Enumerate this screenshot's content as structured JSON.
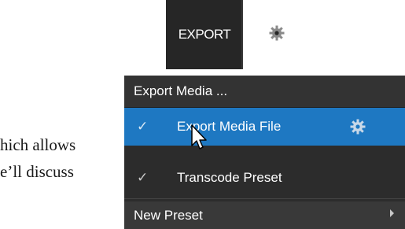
{
  "document": {
    "line1": "hich allows",
    "line2": "e’ll discuss"
  },
  "toolbar": {
    "export_label": "EXPORT",
    "gear_icon": "gear-icon",
    "colors": {
      "background": "#262626",
      "gear": "#8a8a8a"
    }
  },
  "menu": {
    "items": [
      {
        "label": "Export Media ...",
        "checked": false
      },
      {
        "label": "Export Media File",
        "checked": true,
        "check_glyph": "✓",
        "highlighted": true,
        "has_gear": true
      },
      {
        "label": "Transcode Preset",
        "checked": true,
        "check_glyph": "✓"
      },
      {
        "label": "New Preset",
        "has_submenu": true
      }
    ],
    "colors": {
      "background": "#2c2c2c",
      "highlight": "#1e78c2",
      "text": "#ffffff"
    }
  },
  "cursor": {
    "icon": "pointer-arrow-icon"
  }
}
